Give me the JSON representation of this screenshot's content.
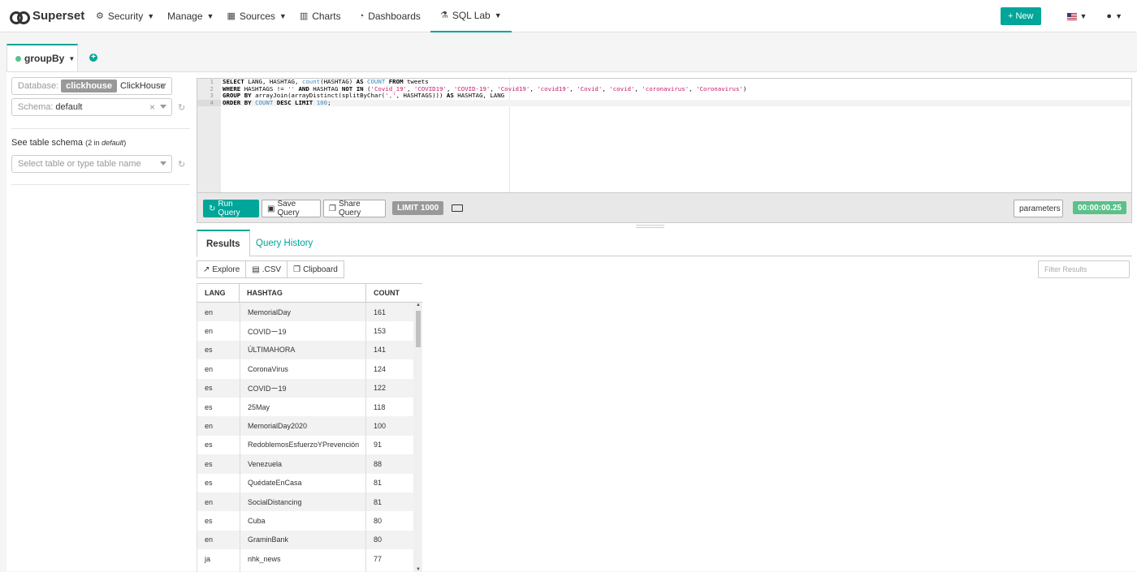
{
  "navbar": {
    "brand": "Superset",
    "items": [
      {
        "label": "Security",
        "icon": "gear-icon",
        "caret": true
      },
      {
        "label": "Manage",
        "icon": "",
        "caret": true
      },
      {
        "label": "Sources",
        "icon": "table-icon",
        "caret": true
      },
      {
        "label": "Charts",
        "icon": "bar-chart-icon",
        "caret": false
      },
      {
        "label": "Dashboards",
        "icon": "dashboard-icon",
        "caret": false
      },
      {
        "label": "SQL Lab",
        "icon": "flask-icon",
        "caret": true
      }
    ],
    "new_button": "+ New",
    "accent": "#00a699"
  },
  "query_tab": {
    "label": "groupBy",
    "status_color": "#5ac189"
  },
  "left_panel": {
    "database_label": "Database:",
    "database_badge": "clickhouse",
    "database_value": "ClickHouse",
    "schema_label": "Schema:",
    "schema_value": "default",
    "table_schema_title": "See table schema",
    "table_schema_count": "(2 in",
    "table_schema_schema": "default",
    "table_schema_close": ")",
    "table_placeholder": "Select table or type table name"
  },
  "editor": {
    "line_numbers": [
      "1",
      "2",
      "3",
      "4"
    ]
  },
  "toolbar": {
    "run": "Run Query",
    "save": "Save Query",
    "share": "Share Query",
    "limit": "LIMIT 1000",
    "parameters": "parameters",
    "timer": "00:00:00.25"
  },
  "results": {
    "tabs": [
      "Results",
      "Query History"
    ],
    "buttons": [
      "Explore",
      ".CSV",
      "Clipboard"
    ],
    "filter_placeholder": "Filter Results",
    "columns": [
      "LANG",
      "HASHTAG",
      "COUNT"
    ],
    "rows": [
      [
        "en",
        "MemorialDay",
        "161"
      ],
      [
        "en",
        "COVIDー19",
        "153"
      ],
      [
        "es",
        "ÚLTIMAHORA",
        "141"
      ],
      [
        "en",
        "CoronaVirus",
        "124"
      ],
      [
        "es",
        "COVIDー19",
        "122"
      ],
      [
        "es",
        "25May",
        "118"
      ],
      [
        "en",
        "MemorialDay2020",
        "100"
      ],
      [
        "es",
        "RedoblemosEsfuerzoYPrevención",
        "91"
      ],
      [
        "es",
        "Venezuela",
        "88"
      ],
      [
        "es",
        "QuédateEnCasa",
        "81"
      ],
      [
        "en",
        "SocialDistancing",
        "81"
      ],
      [
        "es",
        "Cuba",
        "80"
      ],
      [
        "en",
        "GraminBank",
        "80"
      ],
      [
        "ja",
        "nhk_news",
        "77"
      ]
    ]
  }
}
